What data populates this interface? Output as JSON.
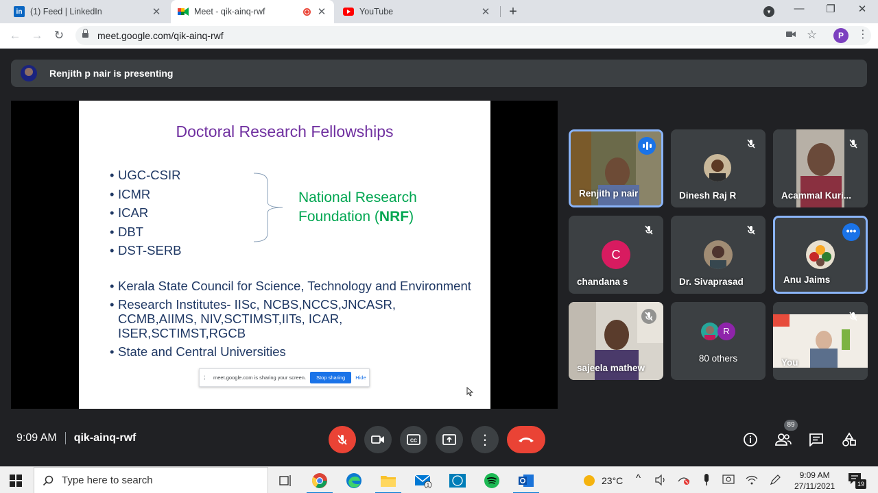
{
  "browser": {
    "tabs": [
      {
        "title": "(1) Feed | LinkedIn",
        "icon": "linkedin-icon",
        "fav_text": "in",
        "color": "#0a66c2"
      },
      {
        "title": "Meet - qik-ainq-rwf",
        "icon": "google-meet-icon",
        "active": true
      },
      {
        "title": "YouTube",
        "icon": "youtube-icon",
        "color": "#ff0000"
      }
    ],
    "url": "meet.google.com/qik-ainq-rwf",
    "profile_initial": "P"
  },
  "meet": {
    "presenting_text": "Renjith p nair is presenting",
    "slide": {
      "title": "Doctoral Research Fellowships",
      "bullets": [
        "UGC-CSIR",
        "ICMR",
        "ICAR",
        "DBT",
        "DST-SERB"
      ],
      "nrf_line1": "National Research",
      "nrf_line2_prefix": "Foundation (",
      "nrf_abbr": "NRF",
      "nrf_line2_suffix": ")",
      "bullets2": [
        "Kerala State Council for Science, Technology and Environment",
        "Research Institutes- IISc, NCBS,NCCS,JNCASR, CCMB,AIIMS, NIV,SCTIMST,IITs, ICAR, ISER,SCTIMST,RGCB",
        "State and Central Universities"
      ]
    },
    "share_notice": {
      "text": "meet.google.com is sharing your screen.",
      "stop_label": "Stop sharing",
      "hide_label": "Hide"
    },
    "participants": [
      {
        "name": "Renjith p nair"
      },
      {
        "name": "Dinesh Raj R"
      },
      {
        "name": "Acammal Kuri..."
      },
      {
        "name": "chandana s",
        "initial": "C"
      },
      {
        "name": "Dr. Sivaprasad"
      },
      {
        "name": "Anu Jaims"
      },
      {
        "name": "sajeela mathew"
      },
      {
        "name": "80 others",
        "initial": "R"
      },
      {
        "name": "You"
      }
    ],
    "bottom": {
      "time": "9:09 AM",
      "meeting_code": "qik-ainq-rwf",
      "people_count": "89"
    }
  },
  "taskbar": {
    "search_placeholder": "Type here to search",
    "temperature": "23°C",
    "clock_time": "9:09 AM",
    "clock_date": "27/11/2021",
    "mail_badge": "1",
    "notification_count": "19"
  },
  "colors": {
    "meet_bg": "#202124",
    "tile_bg": "#3c4043",
    "highlight": "#8ab4f8",
    "end_call": "#ea4335",
    "slide_title": "#7030a0",
    "slide_text": "#1f3864",
    "nrf_green": "#00a651"
  }
}
